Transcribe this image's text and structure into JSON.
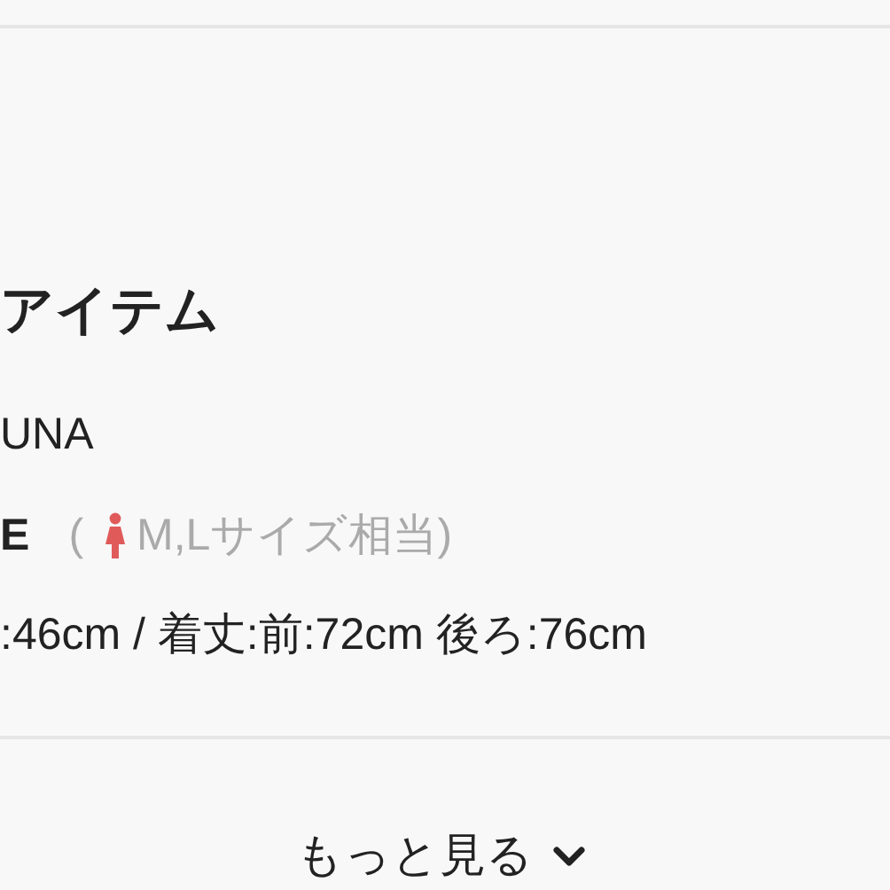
{
  "section": {
    "title": "アイテム"
  },
  "brand": "UNA",
  "size": {
    "label": "E",
    "open_paren": "(",
    "note": "M,Lサイズ相当)"
  },
  "measurements": ":46cm / 着丈:前:72cm  後ろ:76cm",
  "more_button": {
    "label": "もっと見る"
  }
}
